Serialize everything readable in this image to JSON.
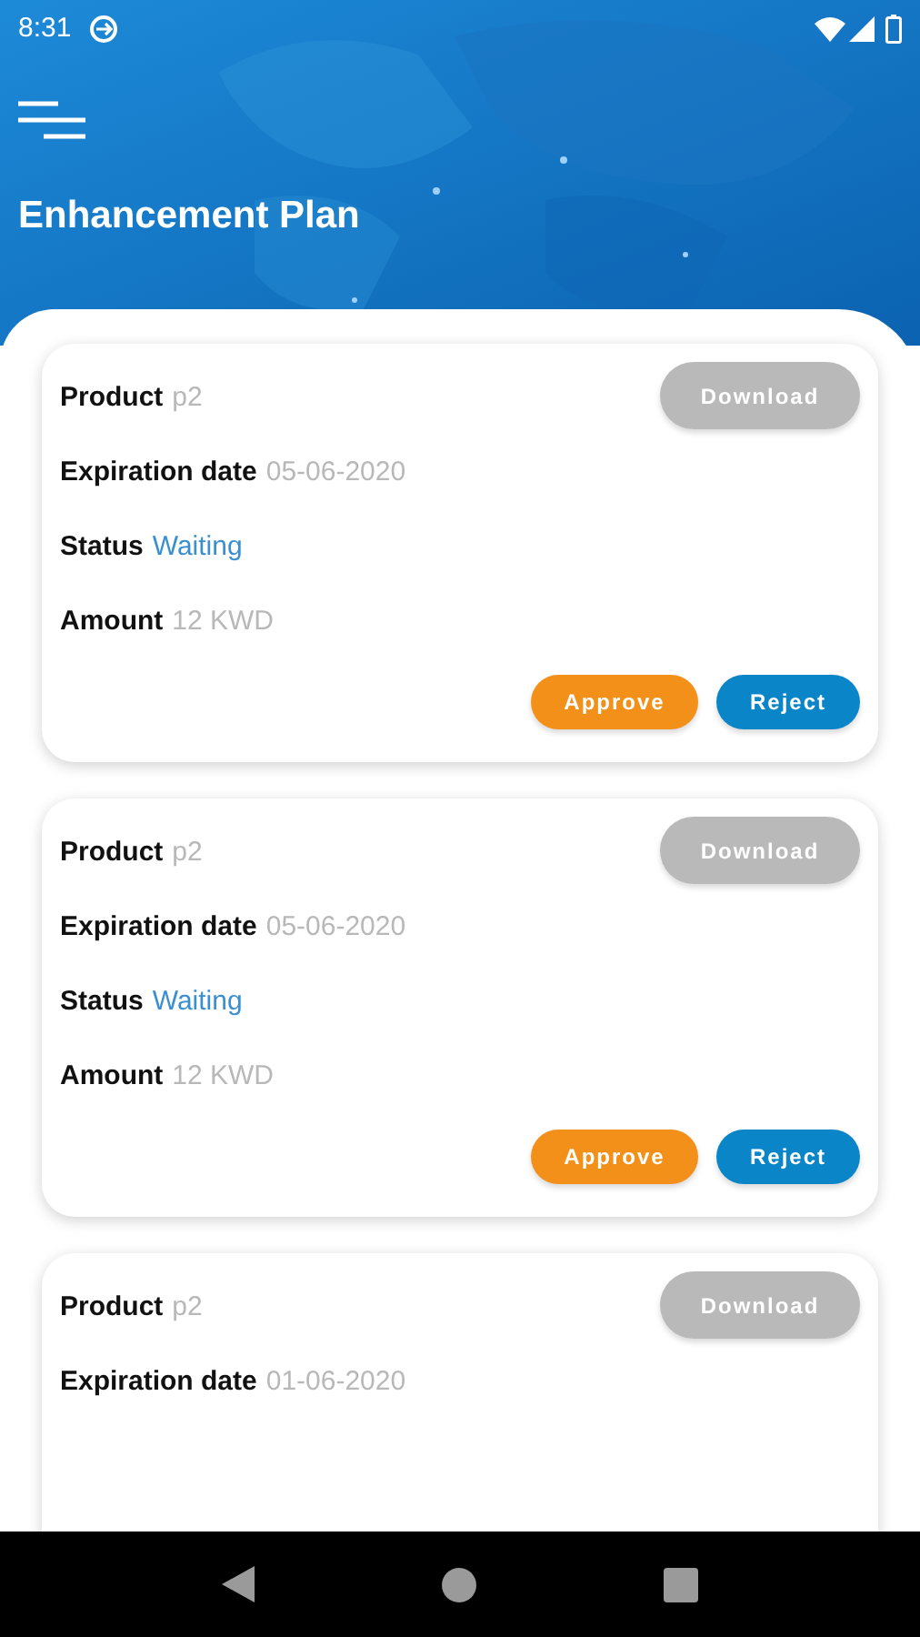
{
  "status_bar": {
    "time": "8:31"
  },
  "header": {
    "title": "Enhancement Plan"
  },
  "cards": [
    {
      "fields": [
        {
          "label": "Product",
          "value": "p2",
          "kind": "plain"
        },
        {
          "label": "Expiration date",
          "value": "05-06-2020",
          "kind": "plain"
        },
        {
          "label": "Status",
          "value": "Waiting",
          "kind": "status"
        },
        {
          "label": "Amount",
          "value": "12 KWD",
          "kind": "plain"
        }
      ],
      "download": {
        "label": "Download",
        "disabled": true
      },
      "actions": [
        {
          "label": "Approve",
          "kind": "approve"
        },
        {
          "label": "Reject",
          "kind": "reject"
        }
      ]
    },
    {
      "fields": [
        {
          "label": "Product",
          "value": "p2",
          "kind": "plain"
        },
        {
          "label": "Expiration date",
          "value": "05-06-2020",
          "kind": "plain"
        },
        {
          "label": "Status",
          "value": "Waiting",
          "kind": "status"
        },
        {
          "label": "Amount",
          "value": "12 KWD",
          "kind": "plain"
        }
      ],
      "download": {
        "label": "Download",
        "disabled": true
      },
      "actions": [
        {
          "label": "Approve",
          "kind": "approve"
        },
        {
          "label": "Reject",
          "kind": "reject"
        }
      ]
    },
    {
      "fields": [
        {
          "label": "Product",
          "value": "p2",
          "kind": "plain"
        },
        {
          "label": "Expiration date",
          "value": "01-06-2020",
          "kind": "plain"
        }
      ],
      "download": {
        "label": "Download",
        "disabled": true
      }
    }
  ]
}
